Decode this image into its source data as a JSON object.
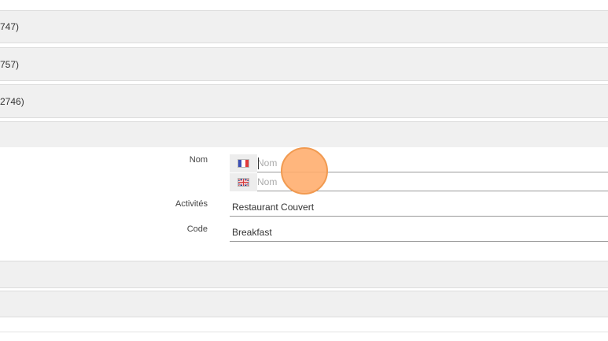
{
  "collapsed_rows": [
    {
      "text": "747)"
    },
    {
      "text": "757)"
    },
    {
      "text": " 2746)"
    },
    {
      "text": ""
    }
  ],
  "form": {
    "nom_label": "Nom",
    "nom_fr": {
      "flag": "french-flag-icon",
      "placeholder": "Nom",
      "value": ""
    },
    "nom_en": {
      "flag": "uk-flag-icon",
      "placeholder": "Nom",
      "value": ""
    },
    "activites_label": "Activités",
    "activites_value": "Restaurant Couvert",
    "code_label": "Code",
    "code_value": "Breakfast"
  },
  "trailing_rows": [
    {
      "text": ""
    },
    {
      "text": ""
    }
  ],
  "colors": {
    "row_background": "#f0f0f0",
    "cursor_highlight": "#ffac6b"
  }
}
